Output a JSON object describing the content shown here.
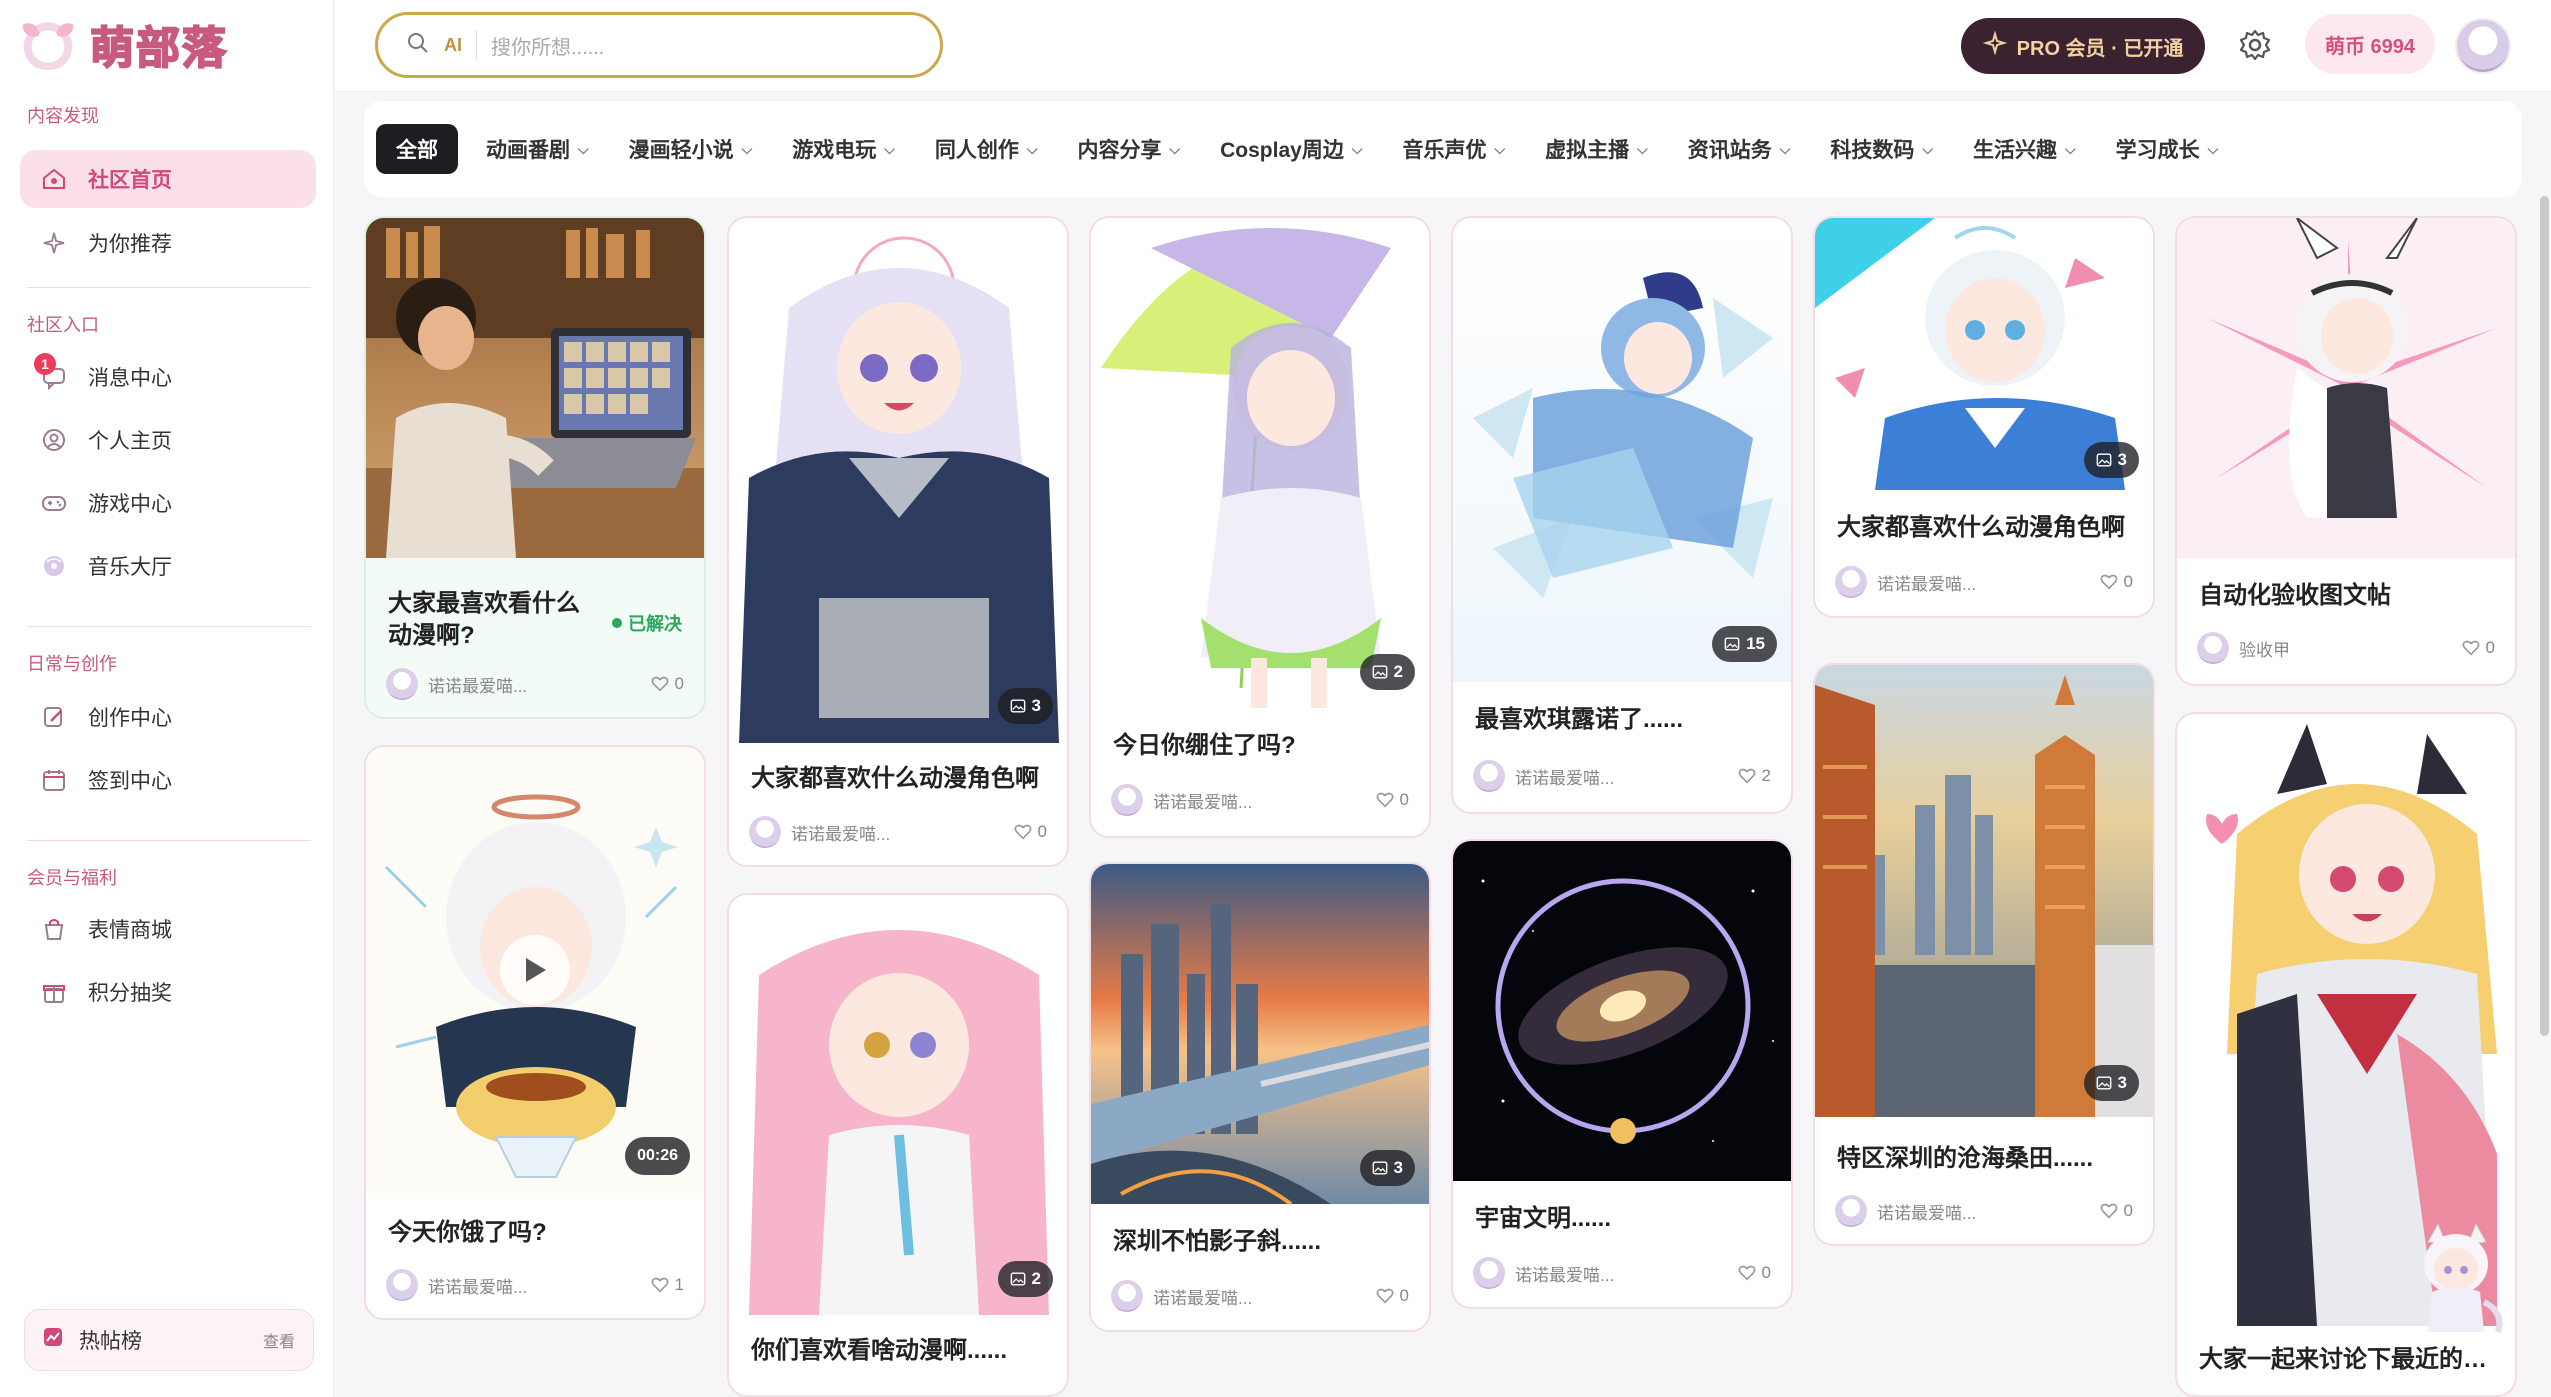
{
  "brand": {
    "name": "萌部落"
  },
  "sidebar": {
    "sections": [
      {
        "title": "内容发现",
        "items": [
          {
            "label": "社区首页",
            "icon": "community-icon",
            "active": true
          },
          {
            "label": "为你推荐",
            "icon": "sparkle-icon"
          }
        ]
      },
      {
        "title": "社区入口",
        "items": [
          {
            "label": "消息中心",
            "icon": "message-icon",
            "badge": "1"
          },
          {
            "label": "个人主页",
            "icon": "user-icon"
          },
          {
            "label": "游戏中心",
            "icon": "gamepad-icon"
          },
          {
            "label": "音乐大厅",
            "icon": "music-icon"
          }
        ]
      },
      {
        "title": "日常与创作",
        "items": [
          {
            "label": "创作中心",
            "icon": "edit-icon"
          },
          {
            "label": "签到中心",
            "icon": "calendar-icon"
          }
        ]
      },
      {
        "title": "会员与福利",
        "items": [
          {
            "label": "表情商城",
            "icon": "shop-icon"
          },
          {
            "label": "积分抽奖",
            "icon": "gift-icon"
          }
        ]
      }
    ],
    "hot": {
      "label": "热帖榜",
      "action": "查看"
    }
  },
  "header": {
    "search": {
      "ai_label": "AI",
      "placeholder": "搜你所想......"
    },
    "pro": {
      "label": "PRO 会员 · 已开通"
    },
    "coins": {
      "label": "萌币 6994"
    }
  },
  "filters": [
    {
      "label": "全部",
      "active": true
    },
    {
      "label": "动画番剧"
    },
    {
      "label": "漫画轻小说"
    },
    {
      "label": "游戏电玩"
    },
    {
      "label": "同人创作"
    },
    {
      "label": "内容分享"
    },
    {
      "label": "Cosplay周边"
    },
    {
      "label": "音乐声优"
    },
    {
      "label": "虚拟主播"
    },
    {
      "label": "资讯站务"
    },
    {
      "label": "科技数码"
    },
    {
      "label": "生活兴趣"
    },
    {
      "label": "学习成长"
    }
  ],
  "posts": [
    {
      "title": "大家最喜欢看什么动漫啊?",
      "author": "诺诺最爱喵...",
      "likes": "0",
      "status": "已解决",
      "scene": "boy-laptop"
    },
    {
      "title": "今天你饿了吗?",
      "author": "诺诺最爱喵...",
      "likes": "1",
      "duration": "00:26",
      "scene": "girl-pudding"
    },
    {
      "title": "大家都喜欢什么动漫角色啊",
      "author": "诺诺最爱喵...",
      "likes": "0",
      "images": "3",
      "scene": "girl-sailor"
    },
    {
      "title": "你们喜欢看啥动漫啊......",
      "author": "诺诺最爱喵...",
      "likes": "0",
      "images": "2",
      "scene": "pink-girl"
    },
    {
      "title": "今日你绷住了吗?",
      "author": "诺诺最爱喵...",
      "likes": "0",
      "images": "2",
      "scene": "umbrella-girl"
    },
    {
      "title": "深圳不怕影子斜......",
      "author": "诺诺最爱喵...",
      "likes": "0",
      "images": "3",
      "scene": "city-bridge"
    },
    {
      "title": "最喜欢琪露诺了......",
      "author": "诺诺最爱喵...",
      "likes": "2",
      "images": "15",
      "scene": "ice-fairy"
    },
    {
      "title": "宇宙文明......",
      "author": "诺诺最爱喵...",
      "likes": "0",
      "scene": "galaxy"
    },
    {
      "title": "大家都喜欢什么动漫角色啊",
      "author": "诺诺最爱喵...",
      "likes": "0",
      "images": "3",
      "scene": "blue-sailor"
    },
    {
      "title": "特区深圳的沧海桑田......",
      "author": "诺诺最爱喵...",
      "likes": "0",
      "images": "3",
      "scene": "city-towers"
    },
    {
      "title": "自动化验收图文帖",
      "author": "验收甲",
      "likes": "0",
      "scene": "bunny-chibi"
    },
    {
      "title": "大家一起来讨论下最近的新番",
      "author": "",
      "likes": "",
      "scene": "cat-girl"
    }
  ]
}
